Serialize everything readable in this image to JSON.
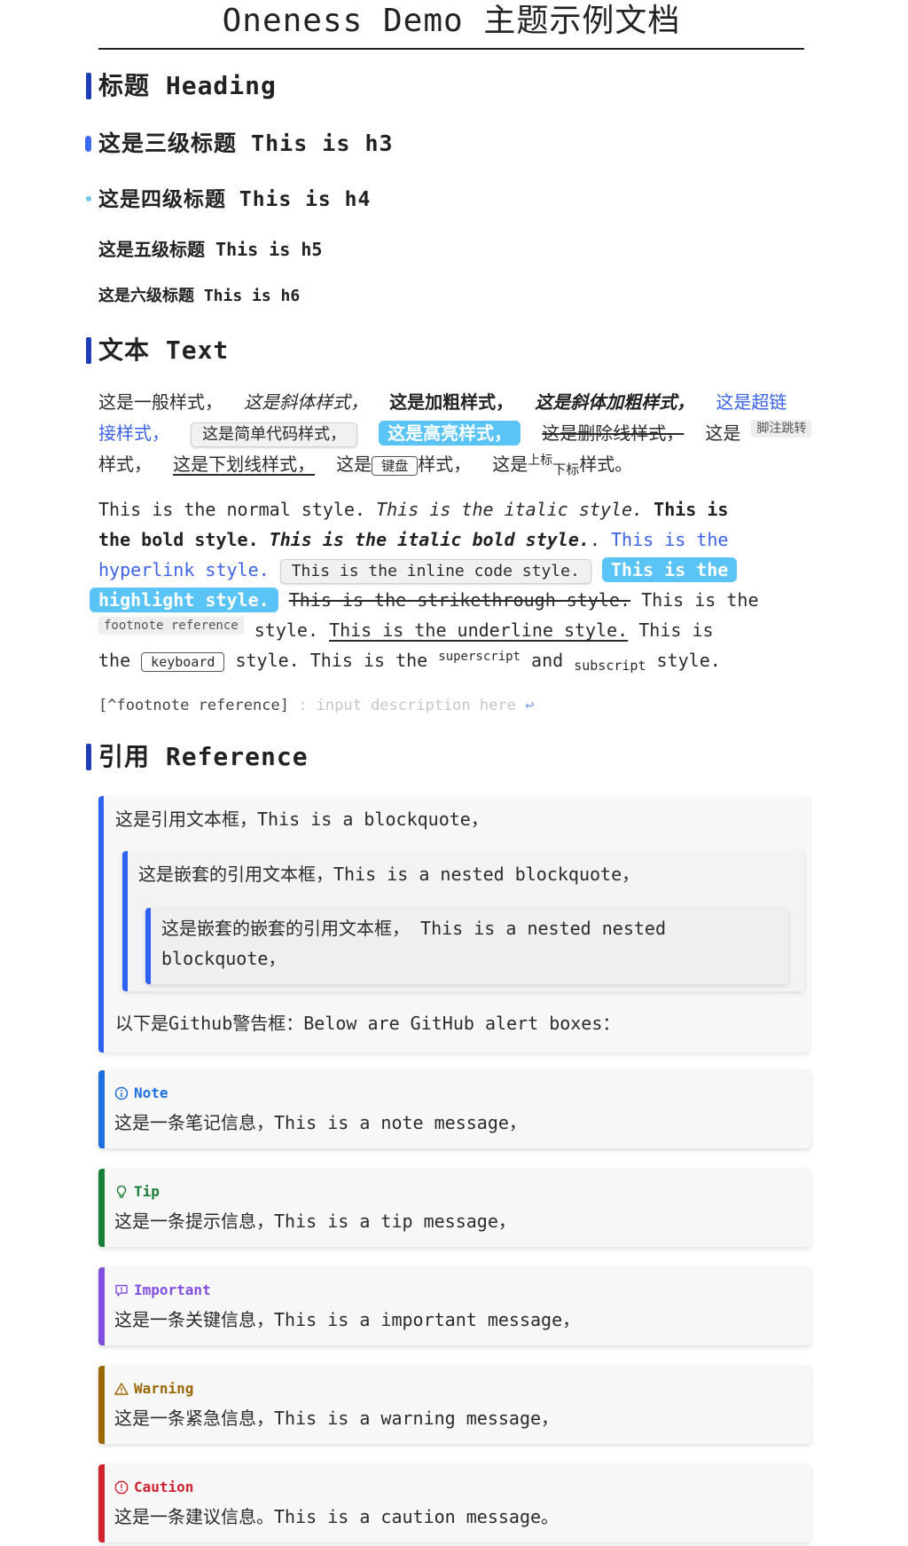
{
  "title": "Oneness Demo 主题示例文档",
  "headings": {
    "h2": "标题 Heading",
    "h3": "这是三级标题 This is h3",
    "h4": "这是四级标题 This is h4",
    "h5": "这是五级标题 This is h5",
    "h6": "这是六级标题 This is h6"
  },
  "text_section": {
    "heading": "文本 Text",
    "cn": {
      "normal": "这是一般样式，",
      "italic": "这是斜体样式，",
      "bold": "这是加粗样式，",
      "bold_italic": "这是斜体加粗样式，",
      "link_a": "这是超链",
      "link_b": "接样式，",
      "code": "这是简单代码样式，",
      "highlight": "这是高亮样式，",
      "strike": "这是删除线样式，",
      "footnote_pre": "这是",
      "footnote_ref": "脚注跳转",
      "footnote_post": "样式，",
      "underline": "这是下划线样式，",
      "kbd_pre": "这是",
      "kbd": "键盘",
      "kbd_post": "样式，",
      "supsub_pre": "这是",
      "sup": "上标",
      "sub": "下标",
      "supsub_post": "样式。"
    },
    "en": {
      "normal": "This is the normal style.",
      "italic": "This is the italic style.",
      "bold_a": "This is",
      "bold_b": "the bold style.",
      "bold_italic": "This is the italic bold style.",
      "dots": ".",
      "link_a": "This is the",
      "link_b": "hyperlink style.",
      "code": "This is the inline code style.",
      "highlight_a": "This is the",
      "highlight_b": "highlight style.",
      "strike": "This is the strikethrough style.",
      "footnote_pre": "This is the",
      "footnote_ref": "footnote reference",
      "footnote_post": "style.",
      "underline": "This is the underline style.",
      "kbd_pre_a": "This is",
      "kbd_pre_b": "the",
      "kbd": "keyboard",
      "kbd_post": "style. This is the",
      "sup": "superscript",
      "and": "and",
      "sub": "subscript",
      "supsub_post": "style."
    },
    "footnote_def": {
      "label": "[^footnote reference]",
      "placeholder": ": input description here",
      "return_icon": "↩"
    }
  },
  "reference_section": {
    "heading": "引用 Reference",
    "bq1": "这是引用文本框，This is a blockquote，",
    "bq2": "这是嵌套的引用文本框，This is a nested blockquote，",
    "bq3_a": "这是嵌套的嵌套的引用文本框， This is a nested nested",
    "bq3_b": "blockquote，",
    "bq_after": "以下是Github警告框：Below are GitHub alert boxes："
  },
  "alerts": [
    {
      "type": "note",
      "title": "Note",
      "icon": "info-icon",
      "color": "#1f6fe0",
      "body": "这是一条笔记信息，This is a note message，"
    },
    {
      "type": "tip",
      "title": "Tip",
      "icon": "lightbulb-icon",
      "color": "#1a7f37",
      "body": "这是一条提示信息，This is a tip message，"
    },
    {
      "type": "important",
      "title": "Important",
      "icon": "message-alert-icon",
      "color": "#8250df",
      "body": "这是一条关键信息，This is a important message，"
    },
    {
      "type": "warning",
      "title": "Warning",
      "icon": "warning-icon",
      "color": "#9a6700",
      "body": "这是一条紧急信息，This is a warning message，"
    },
    {
      "type": "caution",
      "title": "Caution",
      "icon": "stop-icon",
      "color": "#cf222e",
      "body": "这是一条建议信息。This is a caution message。"
    }
  ],
  "colors": {
    "heading_marker": "#1d3fb5",
    "link": "#3c63e6",
    "highlight_bg": "#59c4f5",
    "blockquote_border": "#2f62f2"
  }
}
